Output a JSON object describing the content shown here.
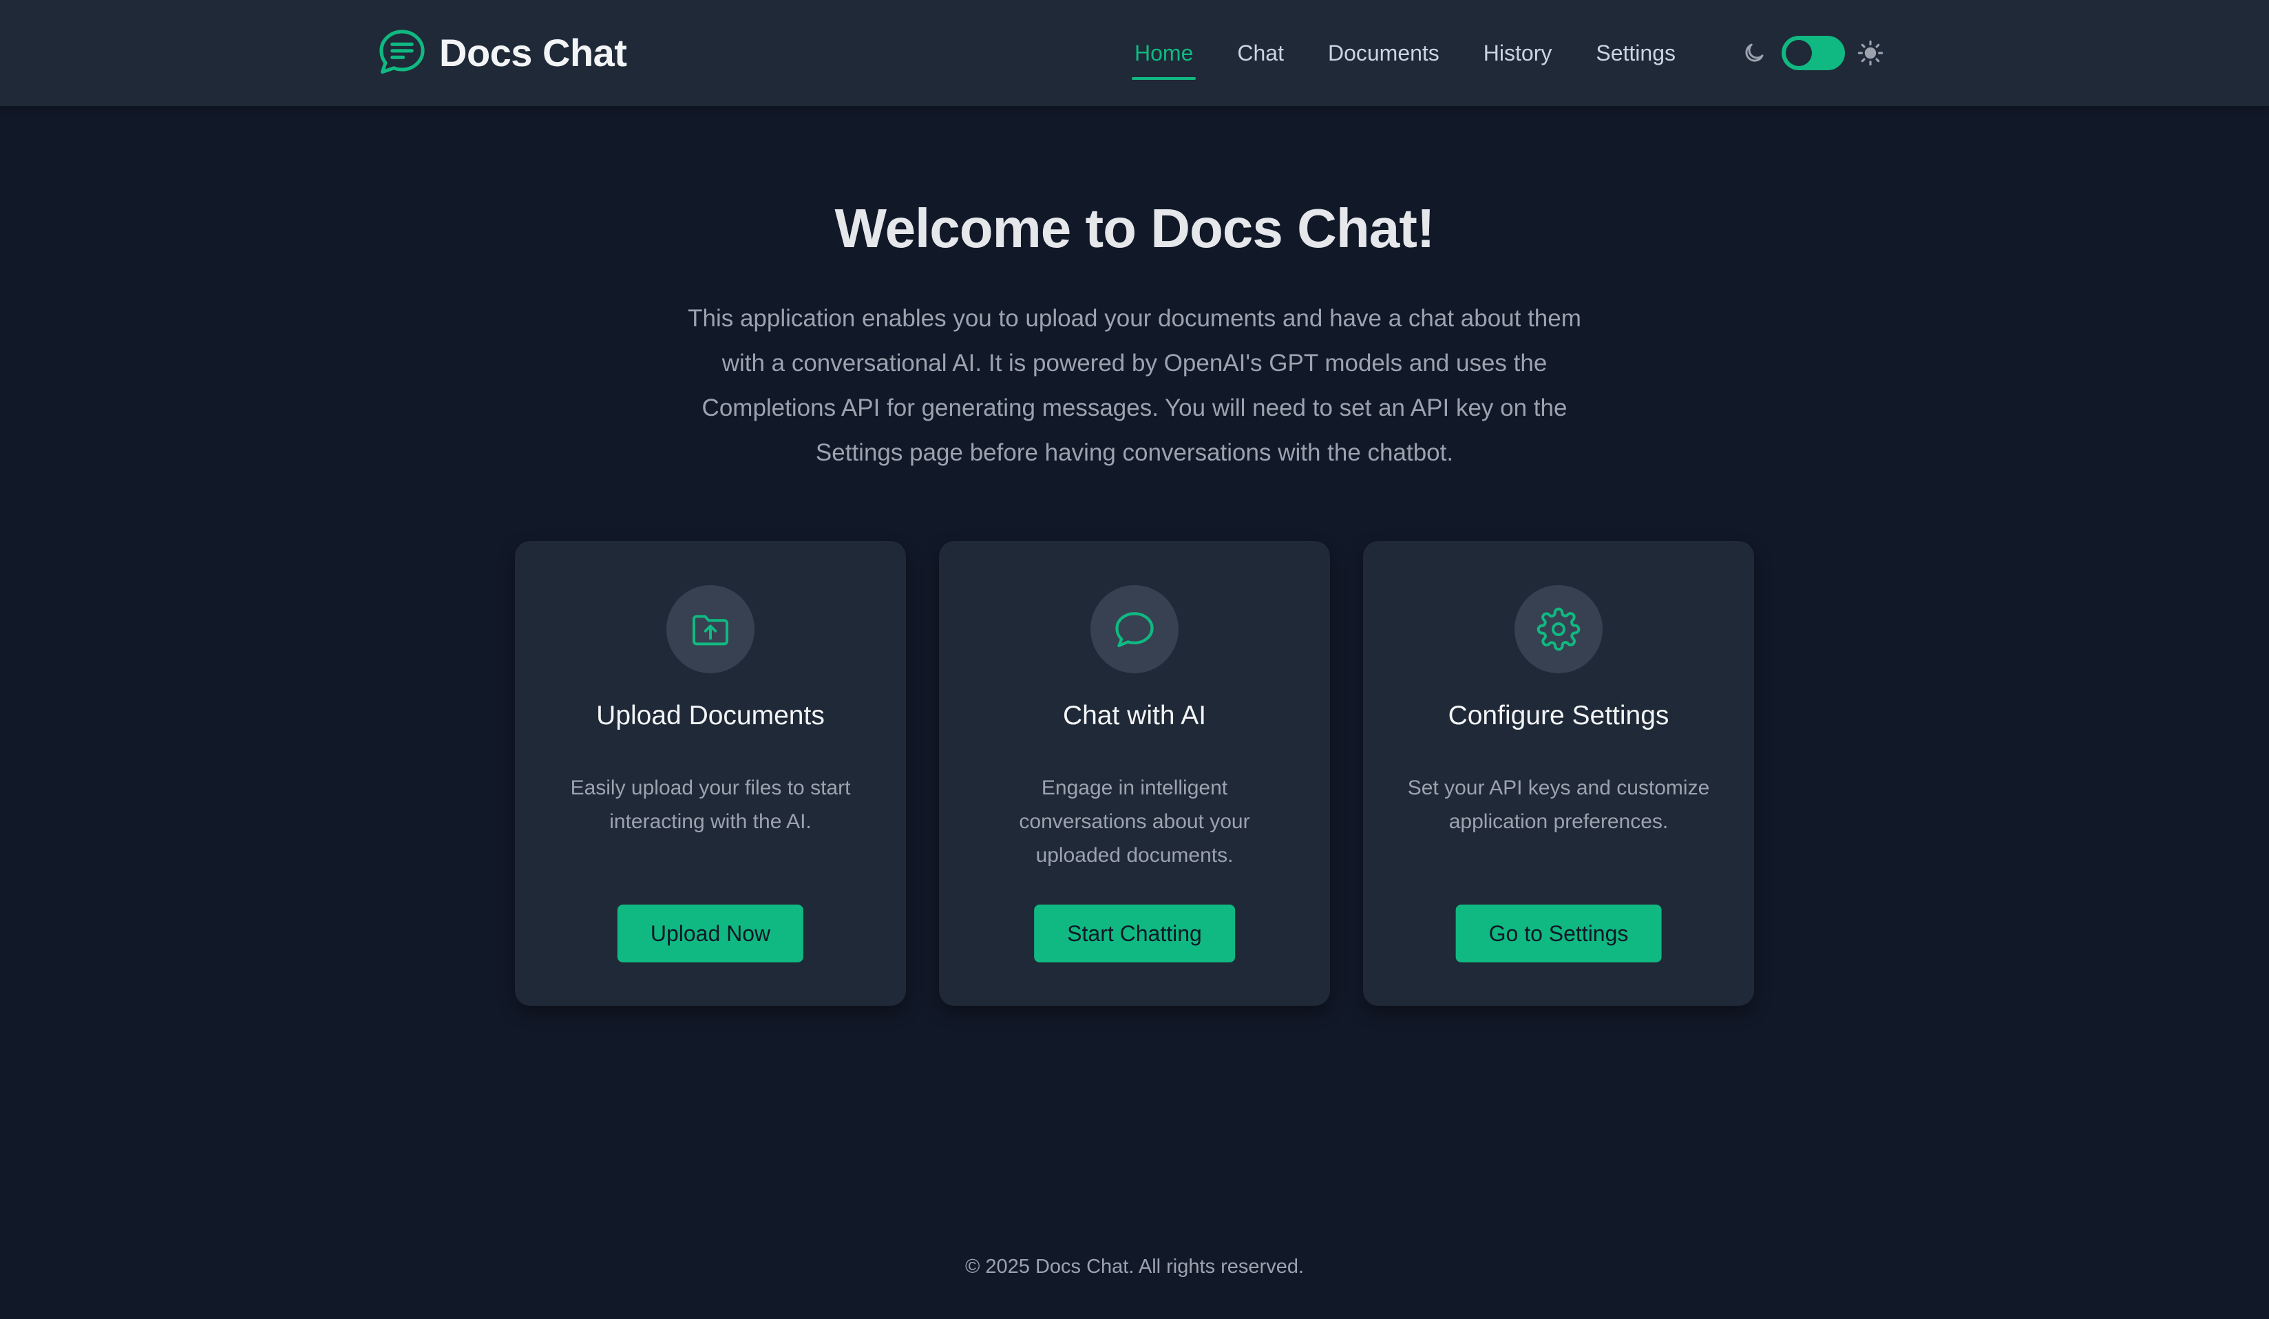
{
  "header": {
    "brand": "Docs Chat",
    "nav": [
      {
        "label": "Home",
        "active": true
      },
      {
        "label": "Chat",
        "active": false
      },
      {
        "label": "Documents",
        "active": false
      },
      {
        "label": "History",
        "active": false
      },
      {
        "label": "Settings",
        "active": false
      }
    ],
    "theme_toggle": {
      "state": "on",
      "left_icon": "moon-icon",
      "right_icon": "sun-icon"
    }
  },
  "hero": {
    "title": "Welcome to Docs Chat!",
    "description": "This application enables you to upload your documents and have a chat about them with a conversational AI. It is powered by OpenAI's GPT models and uses the Completions API for generating messages. You will need to set an API key on the Settings page before having conversations with the chatbot."
  },
  "cards": [
    {
      "icon": "folder-upload-icon",
      "title": "Upload Documents",
      "text": "Easily upload your files to start interacting with the AI.",
      "button": "Upload Now"
    },
    {
      "icon": "chat-bubble-icon",
      "title": "Chat with AI",
      "text": "Engage in intelligent conversations about your uploaded documents.",
      "button": "Start Chatting"
    },
    {
      "icon": "gear-icon",
      "title": "Configure Settings",
      "text": "Set your API keys and customize application preferences.",
      "button": "Go to Settings"
    }
  ],
  "footer": {
    "text": "© 2025 Docs Chat. All rights reserved."
  },
  "colors": {
    "accent": "#10b981",
    "background": "#111827",
    "surface": "#1f2937"
  }
}
